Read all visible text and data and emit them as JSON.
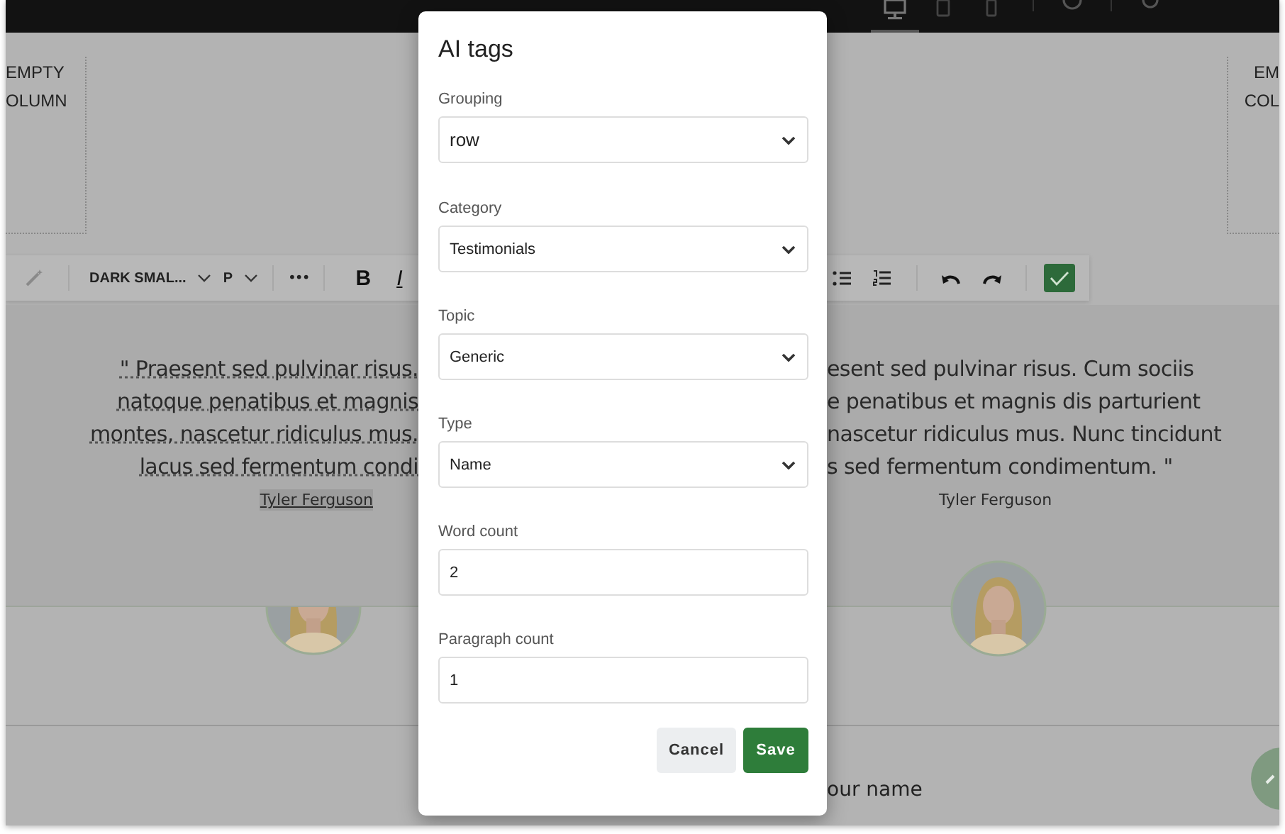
{
  "top_bar": {
    "device_tabs": [
      {
        "kind": "desktop",
        "selected": true
      },
      {
        "kind": "tablet",
        "selected": false
      },
      {
        "kind": "phone",
        "selected": false
      }
    ]
  },
  "canvas": {
    "left_empty_column": [
      "EMPTY",
      "OLUMN"
    ],
    "right_empty_column": [
      "EM",
      "COL"
    ]
  },
  "toolbar": {
    "text_style": "DARK SMAL...",
    "block_type": "P",
    "more": "•••",
    "format_buttons": [
      "B",
      "I"
    ]
  },
  "testimonials": [
    {
      "selected": true,
      "quote_lines": [
        "\" Praesent sed pulvinar risus.",
        "natoque penatibus et magnis",
        "montes, nascetur ridiculus mus.",
        "lacus sed fermentum condi"
      ],
      "author": "Tyler Ferguson"
    },
    {
      "selected": false,
      "quote_lines": [
        "esent sed pulvinar risus. Cum sociis",
        "e penatibus et magnis dis parturient",
        "nascetur ridiculus mus. Nunc tincidunt",
        "s sed fermentum condimentum. \""
      ],
      "author": "Tyler Ferguson"
    }
  ],
  "footer_field": {
    "label": "our name"
  },
  "dialog": {
    "title": "AI tags",
    "fields": [
      {
        "label": "Grouping",
        "kind": "select",
        "value": "row"
      },
      {
        "label": "Category",
        "kind": "select",
        "value": "Testimonials"
      },
      {
        "label": "Topic",
        "kind": "select",
        "value": "Generic"
      },
      {
        "label": "Type",
        "kind": "select",
        "value": "Name"
      },
      {
        "label": "Word count",
        "kind": "input",
        "value": "2"
      },
      {
        "label": "Paragraph count",
        "kind": "input",
        "value": "1"
      }
    ],
    "buttons": [
      {
        "label": "Cancel",
        "kind": "secondary"
      },
      {
        "label": "Save",
        "kind": "primary"
      }
    ]
  }
}
